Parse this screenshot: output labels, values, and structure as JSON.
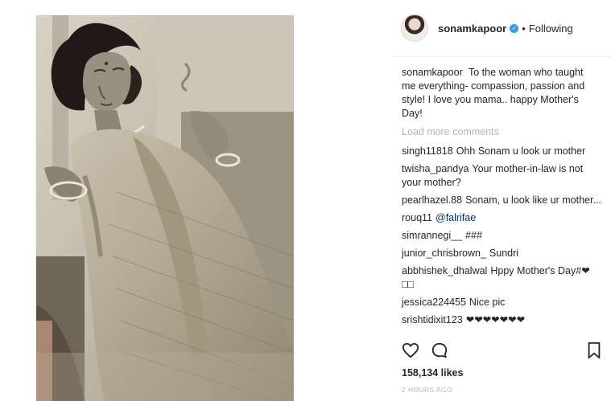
{
  "post": {
    "username": "sonamkapoor",
    "follow_state": "Following",
    "separator": "•",
    "caption_user": "sonamkapoor",
    "caption_text": "To the woman who taught me everything- compassion, passion and style! I love you mama.. happy Mother's Day!",
    "load_more": "Load more comments",
    "likes": "158,134 likes",
    "timestamp": "2 HOURS AGO",
    "icons": {
      "verified": "verified-badge-icon",
      "like": "heart-icon",
      "comment": "comment-icon",
      "save": "bookmark-icon"
    },
    "colors": {
      "verified": "#3897f0",
      "mention": "#003569",
      "muted": "#b5b5b5"
    }
  },
  "comments": [
    {
      "user": "singh11818",
      "text": "Ohh Sonam u look ur mother"
    },
    {
      "user": "twisha_pandya",
      "text": "Your mother-in-law is not your mother?"
    },
    {
      "user": "pearlhazel.88",
      "text": "Sonam, u look like ur mother..."
    },
    {
      "user": "rouq11",
      "text": "@falrifae"
    },
    {
      "user": "simrannegi__",
      "text": "###"
    },
    {
      "user": "junior_chrisbrown_",
      "text": "Sundri"
    },
    {
      "user": "abbhishek_dhalwal",
      "text": "Hppy Mother's Day#❤ □□"
    },
    {
      "user": "jessica224455",
      "text": "Nice pic"
    },
    {
      "user": "srishtidixit123",
      "text": "❤❤❤❤❤❤❤"
    }
  ]
}
